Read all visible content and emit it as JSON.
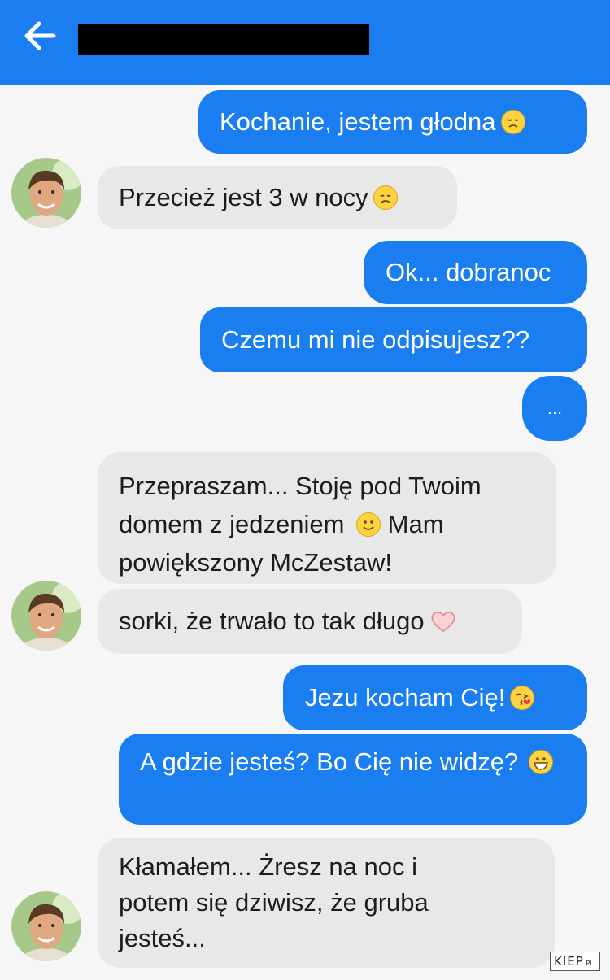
{
  "header": {
    "back_icon": "arrow-left-icon",
    "contact_name_redacted": true
  },
  "messages": [
    {
      "sender": "me",
      "text": "Kochanie, jestem głodna",
      "emoji": "disappointed-face"
    },
    {
      "sender": "them",
      "text": "Przecież jest 3 w nocy",
      "emoji": "disappointed-face"
    },
    {
      "sender": "me",
      "text": "Ok... dobranoc"
    },
    {
      "sender": "me",
      "text": "Czemu mi nie odpisujesz??"
    },
    {
      "sender": "me",
      "text": "..."
    },
    {
      "sender": "them",
      "text_before": "Przepraszam... Stoję pod Twoim domem z jedzeniem",
      "emoji": "smiling-face",
      "text_after": "Mam powiększony McZestaw!"
    },
    {
      "sender": "them",
      "text": "sorki, że trwało to tak długo",
      "emoji": "heart"
    },
    {
      "sender": "me",
      "text": "Jezu kocham Cię!",
      "emoji": "kissing-face"
    },
    {
      "sender": "me",
      "text": "A gdzie jesteś? Bo Cię nie widzę?",
      "emoji": "grinning-face"
    },
    {
      "sender": "them",
      "text": "Kłamałem... Żresz na noc i potem się dziwisz, że gruba jesteś..."
    }
  ],
  "watermark": {
    "main": "KIEP",
    "suffix": ".PL"
  },
  "colors": {
    "accent": "#1a7ef0",
    "incoming_bubble": "#e8e8e8",
    "background": "#f6f6f6"
  }
}
